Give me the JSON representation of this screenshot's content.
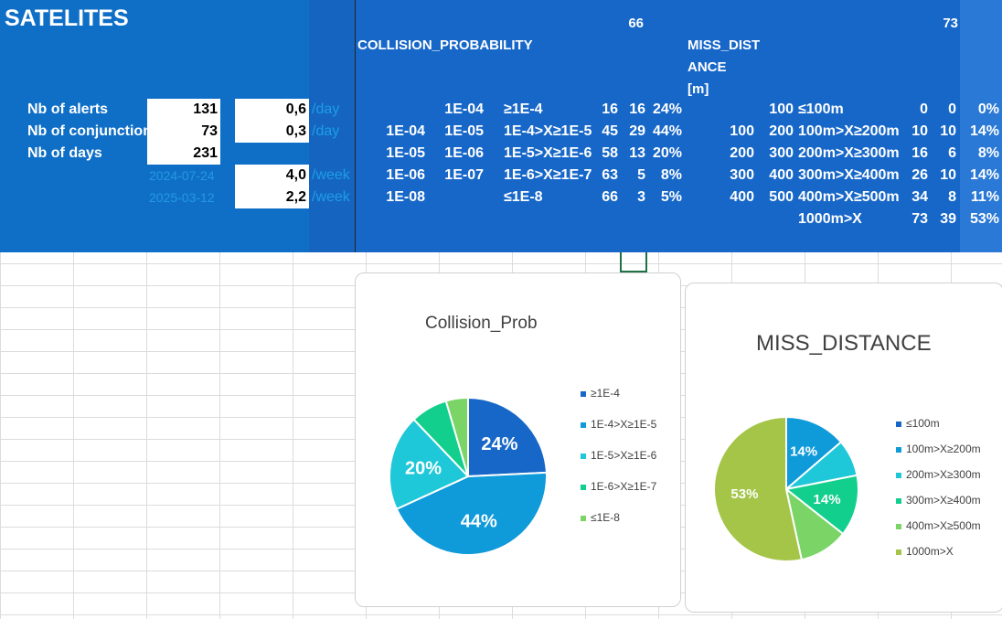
{
  "title": "SATELITES",
  "stats": [
    {
      "label": "Nb of alerts",
      "value": "131",
      "rate": "0,6",
      "unit": "/day"
    },
    {
      "label": "Nb of conjunction",
      "value": "73",
      "rate": "0,3",
      "unit": "/day"
    },
    {
      "label": "Nb of days",
      "value": "231",
      "rate": "",
      "unit": ""
    }
  ],
  "dates": [
    {
      "date": "2024-07-24",
      "rate": "4,0",
      "unit": "/week"
    },
    {
      "date": "2025-03-12",
      "rate": "2,2",
      "unit": "/week"
    }
  ],
  "collision": {
    "header": "COLLISION_PROBABILITY",
    "count": "66",
    "rows": [
      {
        "a": "",
        "b": "1E-04",
        "label": "≥1E-4",
        "c1": "16",
        "c2": "16",
        "pct": "24%"
      },
      {
        "a": "1E-04",
        "b": "1E-05",
        "label": "1E-4>X≥1E-5",
        "c1": "45",
        "c2": "29",
        "pct": "44%"
      },
      {
        "a": "1E-05",
        "b": "1E-06",
        "label": "1E-5>X≥1E-6",
        "c1": "58",
        "c2": "13",
        "pct": "20%"
      },
      {
        "a": "1E-06",
        "b": "1E-07",
        "label": "1E-6>X≥1E-7",
        "c1": "63",
        "c2": "5",
        "pct": "8%"
      },
      {
        "a": "1E-08",
        "b": "",
        "label": "≤1E-8",
        "c1": "66",
        "c2": "3",
        "pct": "5%"
      }
    ]
  },
  "miss": {
    "header_line1": "MISS_DIST",
    "header_line2": "ANCE",
    "header_line3": "[m]",
    "count": "73",
    "rows": [
      {
        "a": "",
        "b": "100",
        "label": "≤100m",
        "c1": "0",
        "c2": "0",
        "pct": "0%"
      },
      {
        "a": "100",
        "b": "200",
        "label": "100m>X≥200m",
        "c1": "10",
        "c2": "10",
        "pct": "14%"
      },
      {
        "a": "200",
        "b": "300",
        "label": "200m>X≥300m",
        "c1": "16",
        "c2": "6",
        "pct": "8%"
      },
      {
        "a": "300",
        "b": "400",
        "label": "300m>X≥400m",
        "c1": "26",
        "c2": "10",
        "pct": "14%"
      },
      {
        "a": "400",
        "b": "500",
        "label": "400m>X≥500m",
        "c1": "34",
        "c2": "8",
        "pct": "11%"
      },
      {
        "a": "",
        "b": "",
        "label": "1000m>X",
        "c1": "73",
        "c2": "39",
        "pct": "53%"
      }
    ]
  },
  "chart_data": [
    {
      "type": "pie",
      "title": "Collision_Prob",
      "categories": [
        "≥1E-4",
        "1E-4>X≥1E-5",
        "1E-5>X≥1E-6",
        "1E-6>X≥1E-7",
        "≤1E-8"
      ],
      "values": [
        16,
        29,
        13,
        5,
        3
      ],
      "labels": [
        "24%",
        "44%",
        "20%",
        "",
        ""
      ],
      "colors": [
        "#1767c8",
        "#0f9ad9",
        "#1ec8d8",
        "#13cf8e",
        "#7ad466"
      ]
    },
    {
      "type": "pie",
      "title": "MISS_DISTANCE",
      "categories": [
        "≤100m",
        "100m>X≥200m",
        "200m>X≥300m",
        "300m>X≥400m",
        "400m>X≥500m",
        "1000m>X"
      ],
      "values": [
        0,
        10,
        6,
        10,
        8,
        39
      ],
      "labels": [
        "",
        "14%",
        "",
        "14%",
        "",
        "53%"
      ],
      "colors": [
        "#1767c8",
        "#0f9ad9",
        "#1ec8d8",
        "#13cf8e",
        "#7ad466",
        "#a4c548"
      ]
    }
  ]
}
